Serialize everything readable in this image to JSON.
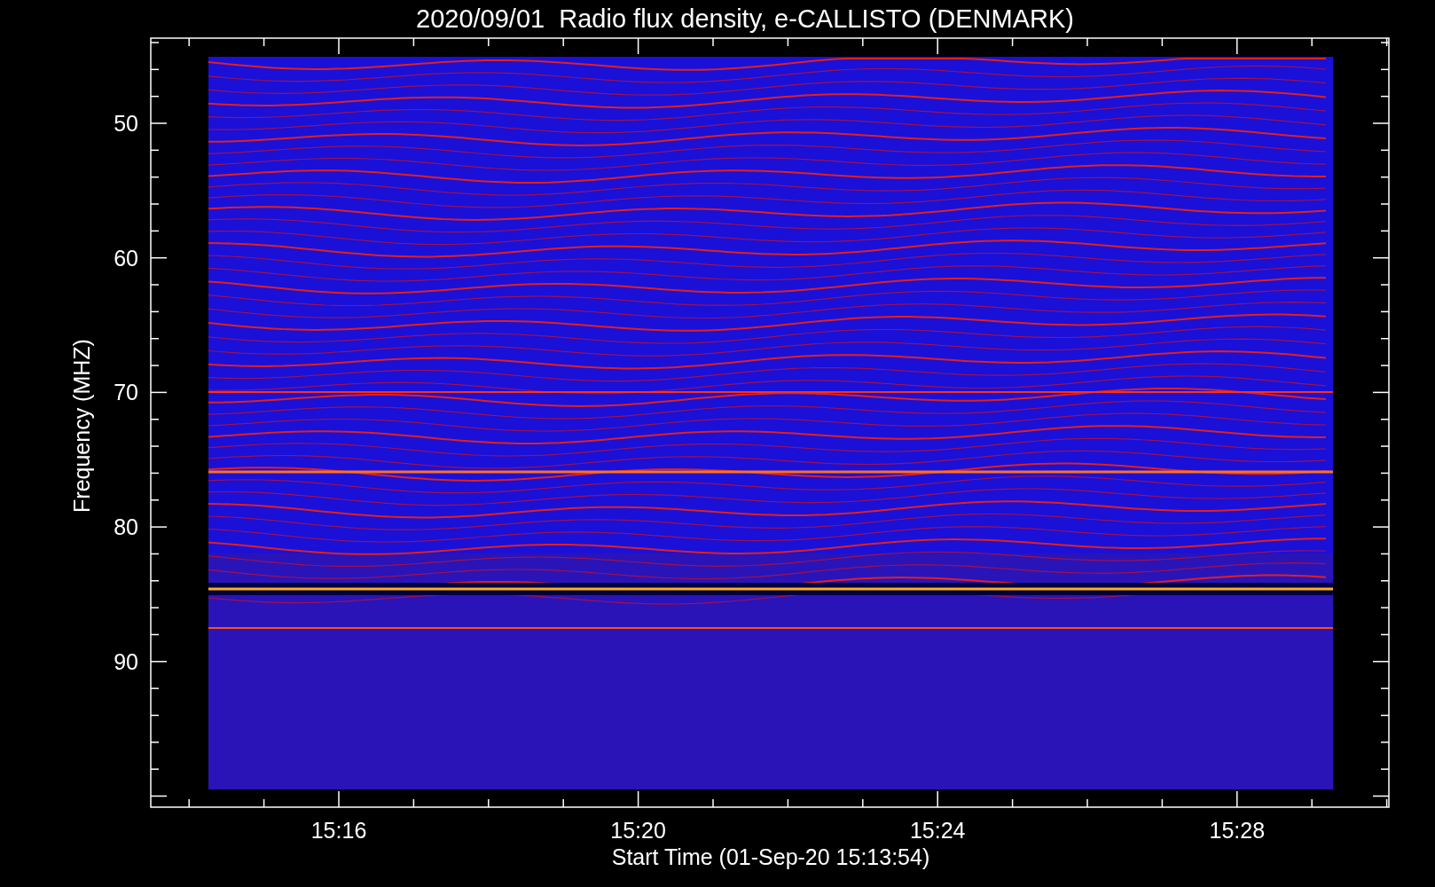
{
  "title": "2020/09/01  Radio flux density, e-CALLISTO (DENMARK)",
  "y_axis": {
    "label": "Frequency (MHZ)",
    "ticks": [
      "50",
      "60",
      "70",
      "80",
      "90"
    ]
  },
  "x_axis": {
    "label": "Start Time (01-Sep-20 15:13:54)",
    "ticks": [
      "15:16",
      "15:20",
      "15:24",
      "15:28"
    ]
  }
}
